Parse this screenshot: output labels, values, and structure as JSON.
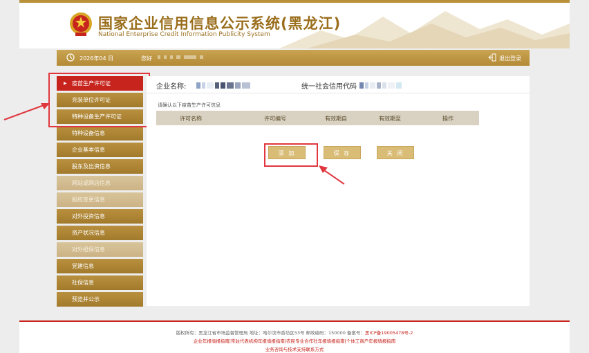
{
  "header": {
    "title": "国家企业信用信息公示系统(黑龙江)",
    "subtitle": "National Enterprise Credit Information Publicity System"
  },
  "infobar": {
    "date": "2026年04  日",
    "greeting": "您好",
    "logout_label": "退出登录"
  },
  "sidebar": {
    "items": [
      {
        "label": "疫苗生产许可证",
        "state": "active"
      },
      {
        "label": "充装单位许可证",
        "state": "normal"
      },
      {
        "label": "特种设备生产许可证",
        "state": "normal"
      },
      {
        "label": "特种设备信息",
        "state": "normal"
      },
      {
        "label": "企业基本信息",
        "state": "normal"
      },
      {
        "label": "股东及出资信息",
        "state": "normal"
      },
      {
        "label": "网站或网店信息",
        "state": "light"
      },
      {
        "label": "股权变更信息",
        "state": "light"
      },
      {
        "label": "对外投资信息",
        "state": "normal"
      },
      {
        "label": "资产状况信息",
        "state": "normal"
      },
      {
        "label": "对外担保信息",
        "state": "light"
      },
      {
        "label": "党建信息",
        "state": "normal"
      },
      {
        "label": "社保信息",
        "state": "normal"
      },
      {
        "label": "预览并公示",
        "state": "normal"
      }
    ]
  },
  "main": {
    "company_name_label": "企业名称:",
    "credit_code_label": "统一社会信用代码",
    "hint": "请确认以下疫苗生产许可信息",
    "table_headers": [
      "许可名称",
      "许可编号",
      "有效期自",
      "有效期至",
      "操作"
    ],
    "buttons": {
      "add": "添 加",
      "save": "保 存",
      "close": "关 闭"
    }
  },
  "footer": {
    "line1": "版权所有：黑龙江省市场监督管理局 地址：哈尔滨市香坊区53号 邮政编码：150000 备案号：",
    "icp": "黑ICP备19005478号-2",
    "line2": "企业年报填报指南|常驻代表机构年报填报指南|农民专业合作社年报填报指南|个体工商户年报填报指南",
    "line3": "业务咨询与技术支持联系方式"
  },
  "colors": {
    "gold": "#b48a36",
    "active_red": "#c7241d",
    "highlight": "#e0373f"
  }
}
